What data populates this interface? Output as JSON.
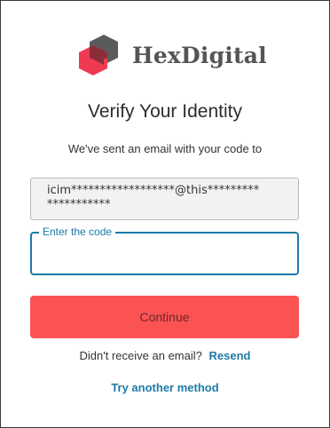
{
  "brand": {
    "name": "HexDigital",
    "logo_icon": "hexdigital-logo-icon",
    "colors": {
      "hex_red": "#f03a52",
      "hex_gray": "#555555",
      "text": "#555555"
    }
  },
  "verify": {
    "title": "Verify Your Identity",
    "subtitle": "We've sent an email with your code to",
    "masked_email": "icim******************@this*********\n***********"
  },
  "code_field": {
    "label": "Enter the code",
    "value": ""
  },
  "continue_button": {
    "label": "Continue",
    "color": "#fb5253"
  },
  "resend": {
    "prompt": "Didn't receive an email?",
    "link_label": "Resend"
  },
  "alternate": {
    "link_label": "Try another method"
  },
  "accent_color": "#1d7aa8"
}
